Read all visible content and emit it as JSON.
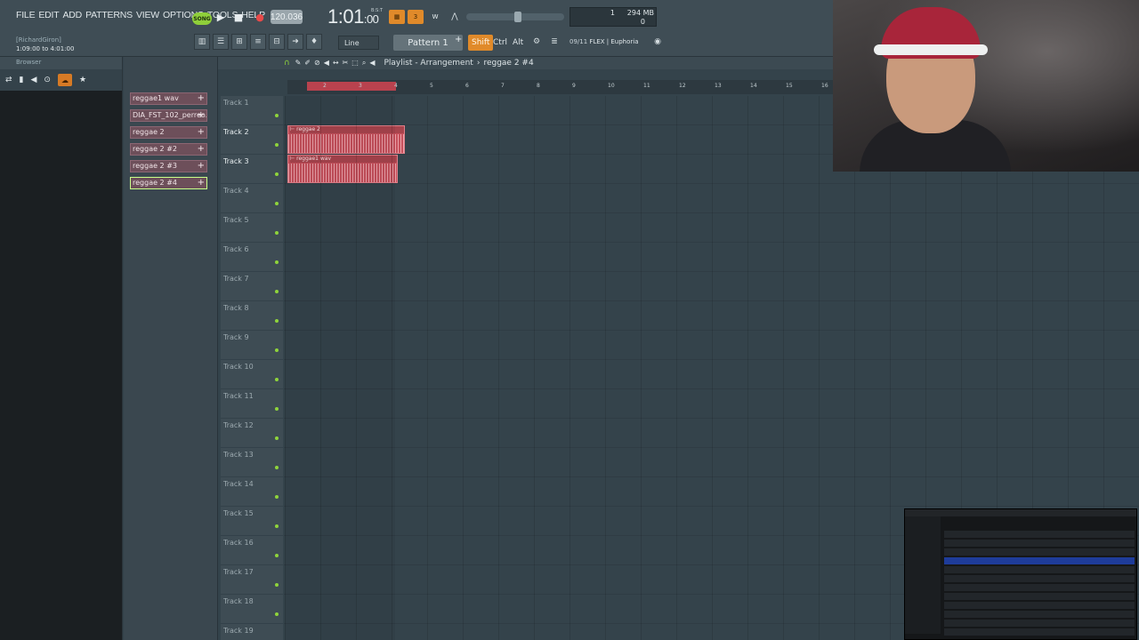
{
  "menu": [
    "FILE",
    "EDIT",
    "ADD",
    "PATTERNS",
    "VIEW",
    "OPTIONS",
    "TOOLS",
    "HELP"
  ],
  "transport": {
    "mode": "SONG",
    "tempo": "120.036",
    "clock": "1:01",
    "clock_ticks": ":00",
    "clock_unit": "B:S:T",
    "cpu": "1",
    "memory": "294 MB",
    "polyphony": "0"
  },
  "hint": {
    "line1": "[RichardGiron]",
    "line2": "1:09:00 to 4:01:00"
  },
  "toolbar": {
    "snap": "Line",
    "pattern": "Pattern 1",
    "shift": "Shift",
    "ctrl": "Ctrl",
    "alt": "Alt",
    "plugin_info": "09/11",
    "plugin_name": "FLEX | Euphoria"
  },
  "browser": {
    "title": "Browser"
  },
  "picker": {
    "items": [
      "reggae1 wav",
      "DIA_FST_102_perreo...",
      "reggae 2",
      "reggae 2 #2",
      "reggae 2 #3",
      "reggae 2 #4"
    ],
    "selected_index": 5
  },
  "playlist": {
    "title": "Playlist - Arrangement",
    "breadcrumb": "reggae 2 #4",
    "bars": [
      "2",
      "3",
      "4",
      "5",
      "6",
      "7",
      "8",
      "9",
      "10",
      "11",
      "12",
      "13",
      "14",
      "15",
      "16"
    ],
    "tracks": [
      "Track 1",
      "Track 2",
      "Track 3",
      "Track 4",
      "Track 5",
      "Track 6",
      "Track 7",
      "Track 8",
      "Track 9",
      "Track 10",
      "Track 11",
      "Track 12",
      "Track 13",
      "Track 14",
      "Track 15",
      "Track 16",
      "Track 17",
      "Track 18",
      "Track 19"
    ],
    "clips": [
      {
        "name": "reggae 2",
        "track": 2
      },
      {
        "name": "reggae1 wav",
        "track": 3
      }
    ]
  },
  "colors": {
    "clip": "#c6505b",
    "accent": "#e08a2a",
    "led": "#8fd43b"
  }
}
